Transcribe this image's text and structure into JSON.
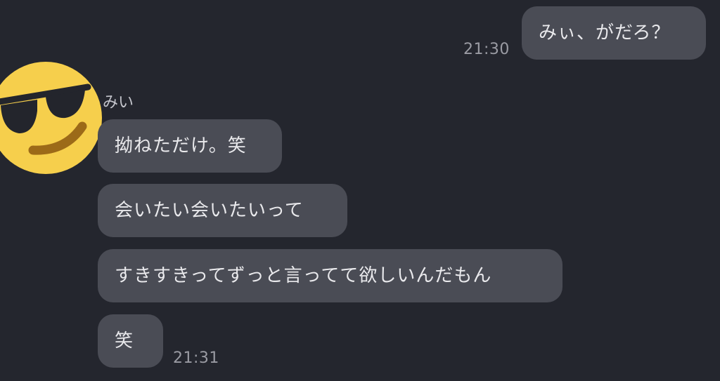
{
  "colors": {
    "background": "#24262e",
    "bubble": "#4a4c55",
    "text": "#e9e9ec",
    "timestamp": "#9a9ba3",
    "avatar_face": "#f6cf4c"
  },
  "sent": {
    "text": "みぃ、がだろ？",
    "time": "21:30"
  },
  "received": {
    "sender_name": "みい",
    "avatar_icon": "sunglasses-emoji-icon",
    "messages": [
      {
        "text": "拗ねただけ。笑"
      },
      {
        "text": "会いたい会いたいって"
      },
      {
        "text": "すきすきってずっと言ってて欲しいんだもん"
      },
      {
        "text": "笑"
      }
    ],
    "time": "21:31"
  }
}
